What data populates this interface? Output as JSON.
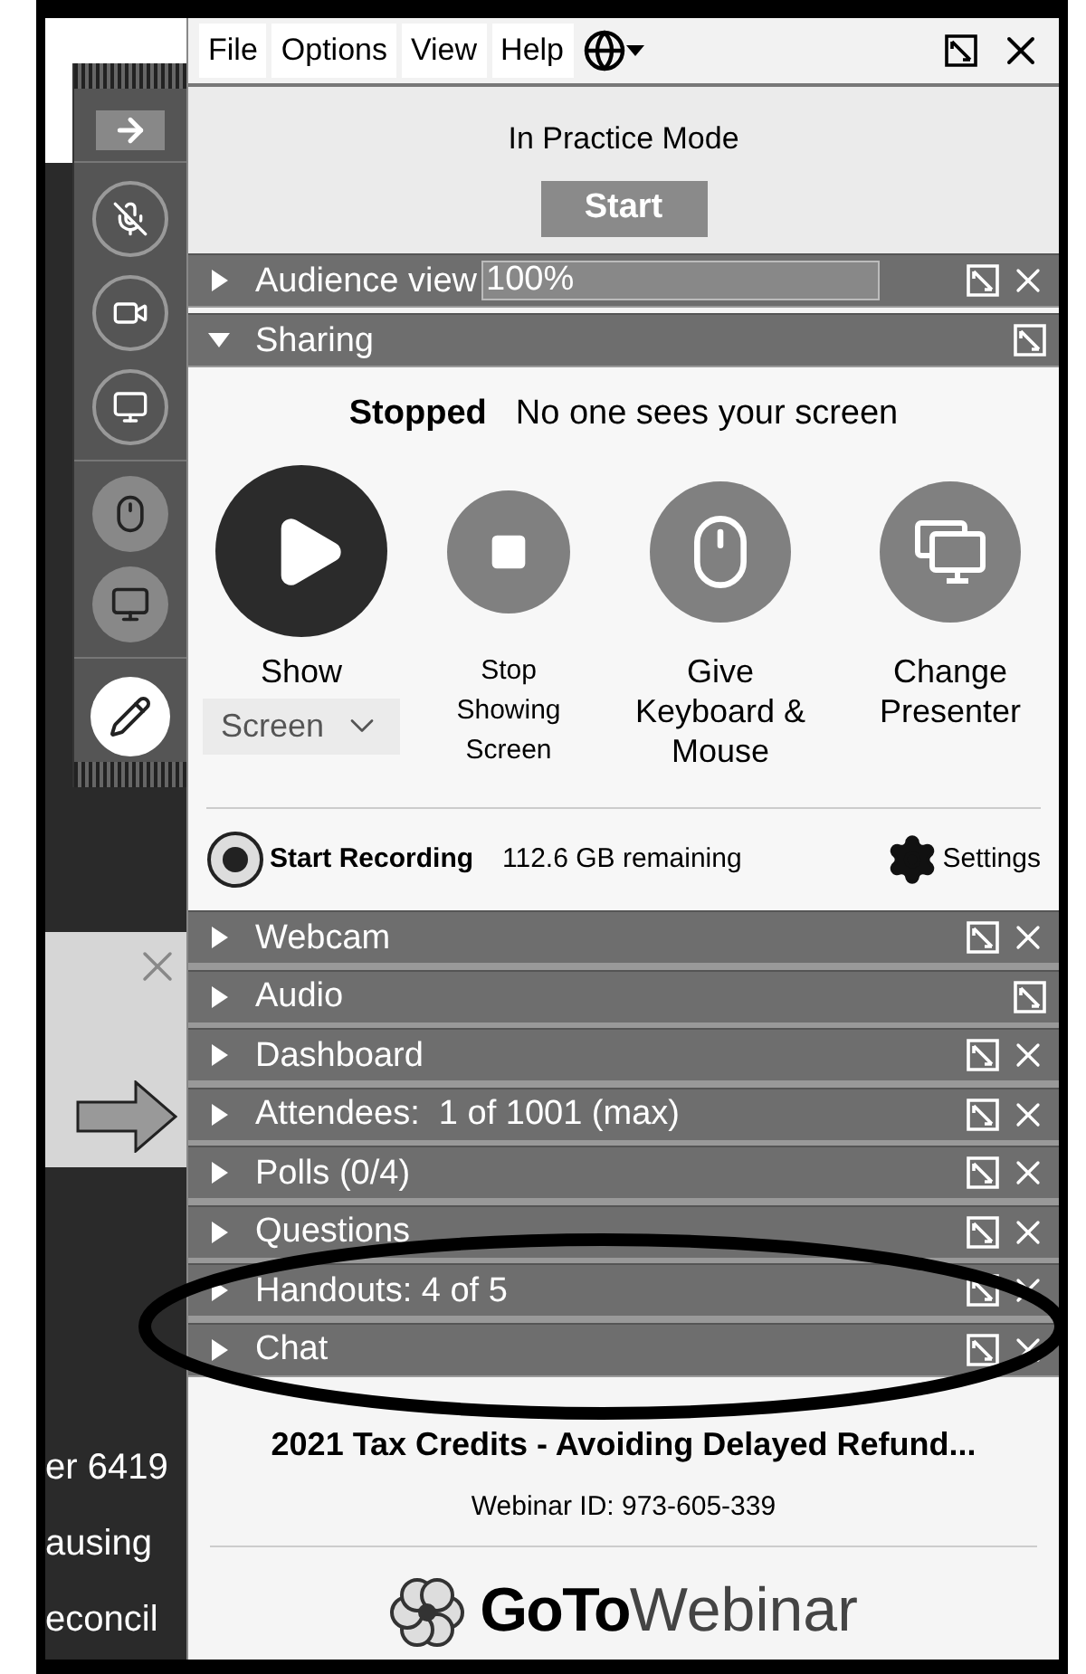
{
  "menu": [
    {
      "label": "File"
    },
    {
      "label": "Options"
    },
    {
      "label": "View"
    },
    {
      "label": "Help"
    }
  ],
  "practice": {
    "label": "In Practice Mode",
    "button": "Start"
  },
  "panels": [
    {
      "title": "Audience view",
      "expanded": false,
      "field_value": "100%",
      "closable": true
    },
    {
      "title": "Sharing",
      "expanded": true,
      "closable": false
    }
  ],
  "sharing": {
    "status": "Stopped",
    "status_text": "No one sees your screen",
    "actions": [
      {
        "kind": "play",
        "label": "Show",
        "dropdown": "Screen"
      },
      {
        "kind": "stop",
        "label": "Stop Showing Screen"
      },
      {
        "kind": "mouse",
        "label": "Give Keyboard & Mouse"
      },
      {
        "kind": "presenter",
        "label": "Change Presenter"
      }
    ],
    "recording": {
      "label": "Start Recording",
      "remaining": "112.6 GB remaining",
      "settings": "Settings"
    }
  },
  "sections": [
    {
      "title": "Webcam",
      "closable": true
    },
    {
      "title": "Audio",
      "closable": false
    },
    {
      "title": "Dashboard",
      "closable": true
    },
    {
      "title": "Attendees:  1 of 1001 (max)",
      "closable": true
    },
    {
      "title": "Polls (0/4)",
      "closable": true
    },
    {
      "title": "Questions",
      "closable": true
    },
    {
      "title": "Handouts: 4 of 5",
      "closable": true
    },
    {
      "title": "Chat",
      "closable": true
    }
  ],
  "footer": {
    "title": "2021 Tax Credits - Avoiding Delayed Refund...",
    "webinar_id": "Webinar ID: 973-605-339",
    "logo_bold": "GoTo",
    "logo_light": "Webinar"
  },
  "background": {
    "texts": [
      "er 6419",
      "ausing",
      "econcil"
    ]
  }
}
